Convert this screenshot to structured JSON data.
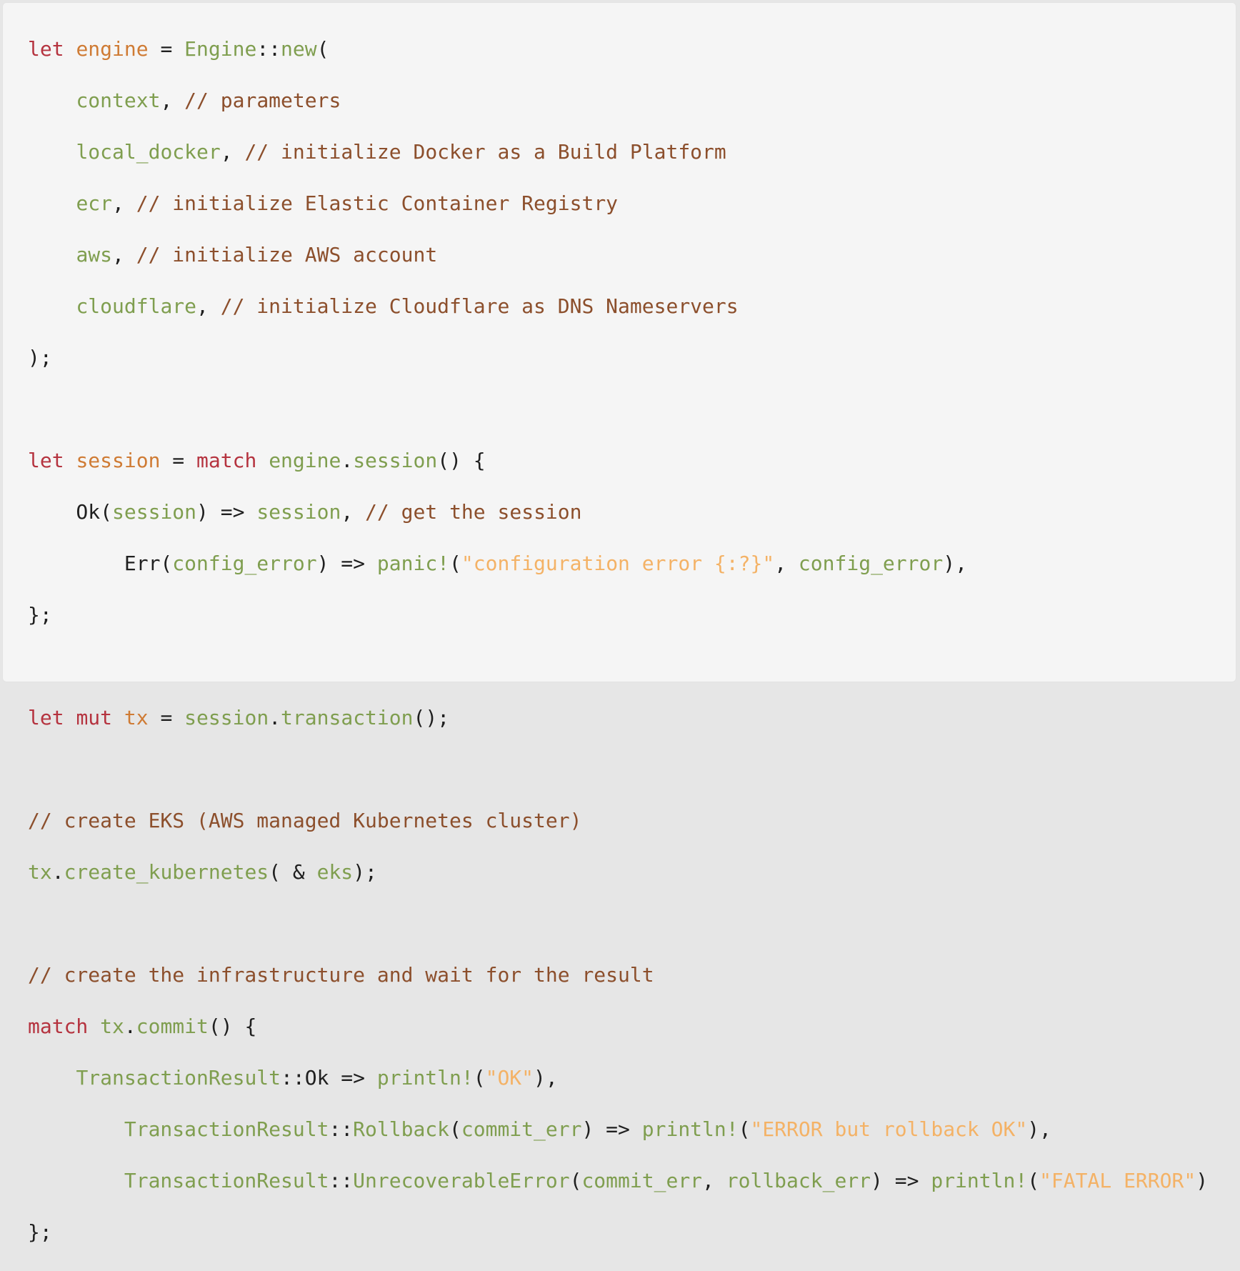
{
  "code": {
    "language": "rust",
    "lines": [
      [
        [
          "kw",
          "let"
        ],
        [
          "p",
          " "
        ],
        [
          "var",
          "engine"
        ],
        [
          "p",
          " = "
        ],
        [
          "fn",
          "Engine"
        ],
        [
          "p",
          "::"
        ],
        [
          "fn",
          "new"
        ],
        [
          "p",
          "("
        ]
      ],
      [
        [
          "p",
          "    "
        ],
        [
          "fn",
          "context"
        ],
        [
          "p",
          ", "
        ],
        [
          "cm",
          "// parameters"
        ]
      ],
      [
        [
          "p",
          "    "
        ],
        [
          "fn",
          "local_docker"
        ],
        [
          "p",
          ", "
        ],
        [
          "cm",
          "// initialize Docker as a Build Platform"
        ]
      ],
      [
        [
          "p",
          "    "
        ],
        [
          "fn",
          "ecr"
        ],
        [
          "p",
          ", "
        ],
        [
          "cm",
          "// initialize Elastic Container Registry"
        ]
      ],
      [
        [
          "p",
          "    "
        ],
        [
          "fn",
          "aws"
        ],
        [
          "p",
          ", "
        ],
        [
          "cm",
          "// initialize AWS account"
        ]
      ],
      [
        [
          "p",
          "    "
        ],
        [
          "fn",
          "cloudflare"
        ],
        [
          "p",
          ", "
        ],
        [
          "cm",
          "// initialize Cloudflare as DNS Nameservers"
        ]
      ],
      [
        [
          "p",
          ");"
        ]
      ],
      [],
      [
        [
          "kw",
          "let"
        ],
        [
          "p",
          " "
        ],
        [
          "var",
          "session"
        ],
        [
          "p",
          " = "
        ],
        [
          "kw",
          "match"
        ],
        [
          "p",
          " "
        ],
        [
          "fn",
          "engine"
        ],
        [
          "p",
          "."
        ],
        [
          "fn",
          "session"
        ],
        [
          "p",
          "() {"
        ]
      ],
      [
        [
          "p",
          "    Ok("
        ],
        [
          "fn",
          "session"
        ],
        [
          "p",
          ") => "
        ],
        [
          "fn",
          "session"
        ],
        [
          "p",
          ", "
        ],
        [
          "cm",
          "// get the session"
        ]
      ],
      [
        [
          "p",
          "        Err("
        ],
        [
          "fn",
          "config_error"
        ],
        [
          "p",
          ") => "
        ],
        [
          "fn",
          "panic!"
        ],
        [
          "p",
          "("
        ],
        [
          "str",
          "\"configuration error {:?}\""
        ],
        [
          "p",
          ", "
        ],
        [
          "fn",
          "config_error"
        ],
        [
          "p",
          "),"
        ]
      ],
      [
        [
          "p",
          "};"
        ]
      ],
      [],
      [
        [
          "kw",
          "let"
        ],
        [
          "p",
          " "
        ],
        [
          "kw",
          "mut"
        ],
        [
          "p",
          " "
        ],
        [
          "var",
          "tx"
        ],
        [
          "p",
          " = "
        ],
        [
          "fn",
          "session"
        ],
        [
          "p",
          "."
        ],
        [
          "fn",
          "transaction"
        ],
        [
          "p",
          "();"
        ]
      ],
      [],
      [
        [
          "cm",
          "// create EKS (AWS managed Kubernetes cluster)"
        ]
      ],
      [
        [
          "fn",
          "tx"
        ],
        [
          "p",
          "."
        ],
        [
          "fn",
          "create_kubernetes"
        ],
        [
          "p",
          "( & "
        ],
        [
          "fn",
          "eks"
        ],
        [
          "p",
          ");"
        ]
      ],
      [],
      [
        [
          "cm",
          "// create the infrastructure and wait for the result"
        ]
      ],
      [
        [
          "kw",
          "match"
        ],
        [
          "p",
          " "
        ],
        [
          "fn",
          "tx"
        ],
        [
          "p",
          "."
        ],
        [
          "fn",
          "commit"
        ],
        [
          "p",
          "() {"
        ]
      ],
      [
        [
          "p",
          "    "
        ],
        [
          "fn",
          "TransactionResult"
        ],
        [
          "p",
          "::Ok => "
        ],
        [
          "fn",
          "println!"
        ],
        [
          "p",
          "("
        ],
        [
          "str",
          "\"OK\""
        ],
        [
          "p",
          "),"
        ]
      ],
      [
        [
          "p",
          "        "
        ],
        [
          "fn",
          "TransactionResult"
        ],
        [
          "p",
          "::"
        ],
        [
          "fn",
          "Rollback"
        ],
        [
          "p",
          "("
        ],
        [
          "fn",
          "commit_err"
        ],
        [
          "p",
          ") => "
        ],
        [
          "fn",
          "println!"
        ],
        [
          "p",
          "("
        ],
        [
          "str",
          "\"ERROR but rollback OK\""
        ],
        [
          "p",
          "),"
        ]
      ],
      [
        [
          "p",
          "        "
        ],
        [
          "fn",
          "TransactionResult"
        ],
        [
          "p",
          "::"
        ],
        [
          "fn",
          "UnrecoverableError"
        ],
        [
          "p",
          "("
        ],
        [
          "fn",
          "commit_err"
        ],
        [
          "p",
          ", "
        ],
        [
          "fn",
          "rollback_err"
        ],
        [
          "p",
          ") => "
        ],
        [
          "fn",
          "println!"
        ],
        [
          "p",
          "("
        ],
        [
          "str",
          "\"FATAL ERROR\""
        ],
        [
          "p",
          ")"
        ]
      ],
      [
        [
          "p",
          "};"
        ]
      ]
    ]
  },
  "colors": {
    "background": "#f5f5f5",
    "keyword": "#b5333f",
    "variable": "#cf7b34",
    "function": "#7f9e4f",
    "comment": "#8c4f2c",
    "string": "#f4b266",
    "plain": "#1f1f1f"
  }
}
